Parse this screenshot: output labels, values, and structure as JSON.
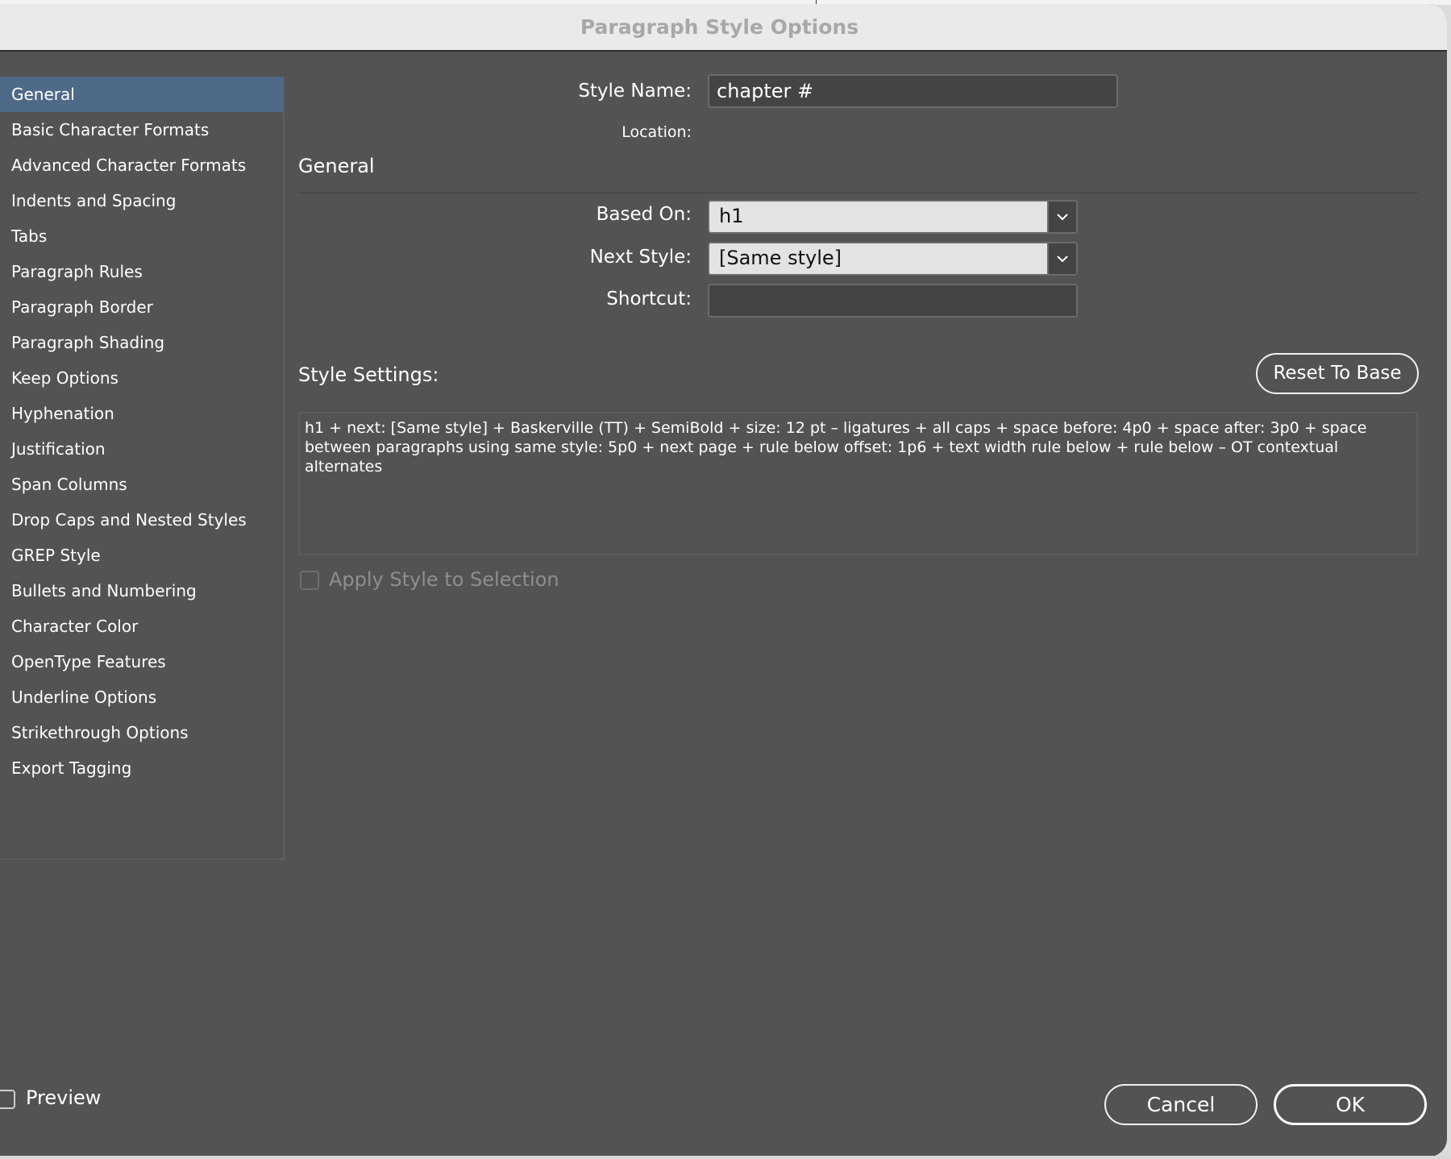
{
  "window": {
    "title": "Paragraph Style Options"
  },
  "sidebar": {
    "items": [
      {
        "label": "General",
        "active": true
      },
      {
        "label": "Basic Character Formats"
      },
      {
        "label": "Advanced Character Formats"
      },
      {
        "label": "Indents and Spacing"
      },
      {
        "label": "Tabs"
      },
      {
        "label": "Paragraph Rules"
      },
      {
        "label": "Paragraph Border"
      },
      {
        "label": "Paragraph Shading"
      },
      {
        "label": "Keep Options"
      },
      {
        "label": "Hyphenation"
      },
      {
        "label": "Justification"
      },
      {
        "label": "Span Columns"
      },
      {
        "label": "Drop Caps and Nested Styles"
      },
      {
        "label": "GREP Style"
      },
      {
        "label": "Bullets and Numbering"
      },
      {
        "label": "Character Color"
      },
      {
        "label": "OpenType Features"
      },
      {
        "label": "Underline Options"
      },
      {
        "label": "Strikethrough Options"
      },
      {
        "label": "Export Tagging"
      }
    ]
  },
  "form": {
    "style_name_label": "Style Name:",
    "style_name_value": "chapter #",
    "location_label": "Location:",
    "section_title": "General",
    "based_on_label": "Based On:",
    "based_on_value": "h1",
    "next_style_label": "Next Style:",
    "next_style_value": "[Same style]",
    "shortcut_label": "Shortcut:",
    "shortcut_value": "",
    "style_settings_label": "Style Settings:",
    "reset_button": "Reset To Base",
    "style_settings_text": "h1 + next: [Same style] + Baskerville (TT) + SemiBold + size: 12 pt – ligatures + all caps + space before: 4p0 + space after: 3p0 + space between paragraphs using same style: 5p0 + next page + rule below offset: 1p6 + text width rule below + rule below – OT contextual alternates",
    "apply_style_label": "Apply Style to Selection",
    "apply_style_checked": false,
    "apply_style_enabled": false
  },
  "footer": {
    "preview_label": "Preview",
    "preview_checked": false,
    "cancel_button": "Cancel",
    "ok_button": "OK"
  },
  "colors": {
    "dialog_bg": "#535353",
    "selected_item": "#4f6a87",
    "titlebar_bg": "#ebeae8"
  }
}
